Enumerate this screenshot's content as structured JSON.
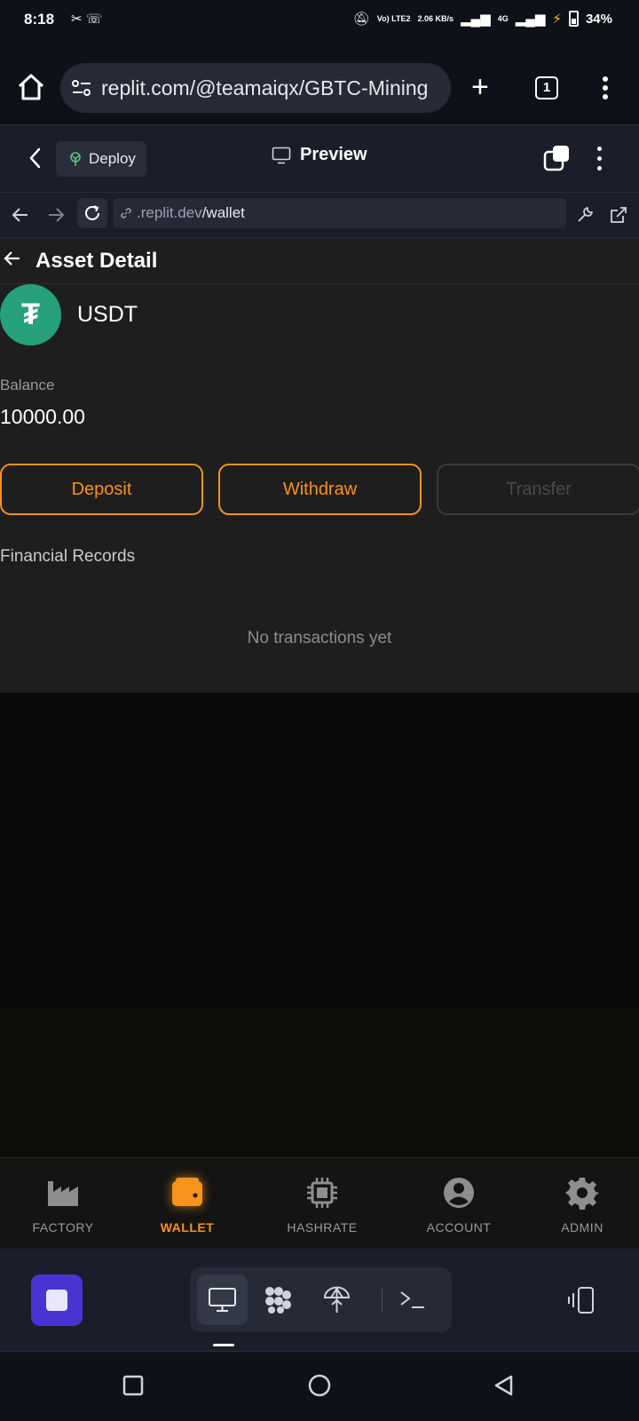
{
  "status_bar": {
    "time": "8:18",
    "net_type": "Vo) LTE2",
    "speed": "2.06 KB/s",
    "network": "4G",
    "battery": "34%"
  },
  "browser": {
    "url": "replit.com/@teamaiqx/GBTC-Mining",
    "tab_count": "1"
  },
  "replit": {
    "deploy_label": "Deploy",
    "preview_label": "Preview",
    "webview_host": ".replit.dev",
    "webview_path": "/wallet"
  },
  "asset_detail": {
    "title": "Asset Detail",
    "coin_symbol": "₮",
    "coin_name": "USDT",
    "balance_label": "Balance",
    "balance_value": "10000.00",
    "buttons": {
      "deposit": "Deposit",
      "withdraw": "Withdraw",
      "transfer": "Transfer"
    },
    "records_title": "Financial Records",
    "empty_message": "No transactions yet"
  },
  "app_nav": {
    "items": [
      {
        "label": "FACTORY",
        "icon": "factory-icon"
      },
      {
        "label": "WALLET",
        "icon": "wallet-icon",
        "active": true
      },
      {
        "label": "HASHRATE",
        "icon": "chip-icon"
      },
      {
        "label": "ACCOUNT",
        "icon": "account-icon"
      },
      {
        "label": "ADMIN",
        "icon": "gear-icon"
      }
    ]
  },
  "colors": {
    "accent": "#f7931a",
    "usdt": "#26a17b",
    "replit_stop": "#4a34d1"
  }
}
